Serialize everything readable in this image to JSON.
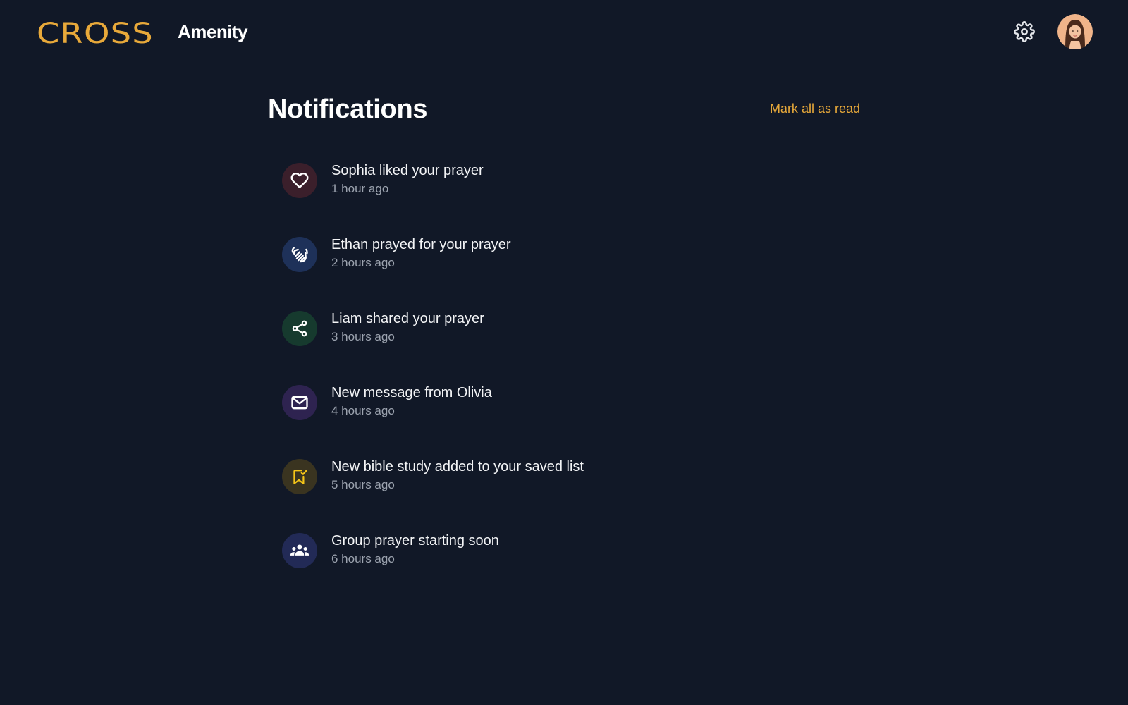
{
  "header": {
    "logo_text": "CROSS",
    "app_name": "Amenity",
    "settings_icon": "gear-icon",
    "avatar_icon": "user-avatar"
  },
  "main": {
    "title": "Notifications",
    "mark_all_label": "Mark all as read"
  },
  "notifications": [
    {
      "title": "Sophia liked your prayer",
      "time": "1 hour ago",
      "icon": "heart-icon",
      "icon_bg": "#3b1f2b",
      "icon_color": "#ffffff"
    },
    {
      "title": "Ethan prayed for your prayer",
      "time": "2 hours ago",
      "icon": "praying-hands-icon",
      "icon_bg": "#1e3159",
      "icon_color": "#ffffff"
    },
    {
      "title": "Liam shared your prayer",
      "time": "3 hours ago",
      "icon": "share-icon",
      "icon_bg": "#163a2e",
      "icon_color": "#ffffff"
    },
    {
      "title": "New message from Olivia",
      "time": "4 hours ago",
      "icon": "envelope-icon",
      "icon_bg": "#2e2350",
      "icon_color": "#ffffff"
    },
    {
      "title": "New bible study added to your saved list",
      "time": "5 hours ago",
      "icon": "bookmark-check-icon",
      "icon_bg": "#3a3420",
      "icon_color": "#f5c518"
    },
    {
      "title": "Group prayer starting soon",
      "time": "6 hours ago",
      "icon": "group-icon",
      "icon_bg": "#222a56",
      "icon_color": "#ffffff"
    }
  ],
  "colors": {
    "background": "#111827",
    "accent": "#e8a93a",
    "text_secondary": "#9ca3af"
  }
}
